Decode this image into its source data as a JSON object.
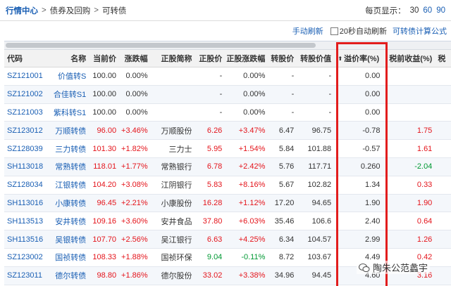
{
  "breadcrumb": {
    "home": "行情中心",
    "level2": "债券及回购",
    "level3": "可转债"
  },
  "page_size": {
    "label": "每页显示：",
    "options": [
      "30",
      "60",
      "90"
    ]
  },
  "toolbar": {
    "manual_refresh": "手动刷新",
    "auto_refresh": "20秒自动刷新",
    "formula": "可转债计算公式"
  },
  "columns": {
    "code": "代码",
    "name": "名称",
    "price": "当前价",
    "change": "涨跌幅",
    "stock_name": "正股简称",
    "stock_price": "正股价",
    "stock_change": "正股涨跌幅",
    "conv_price": "转股价",
    "conv_value": "转股价值",
    "premium": "溢价率(%)",
    "yield": "税前收益(%)",
    "tax": "税"
  },
  "sort_indicator": "⬆",
  "rows": [
    {
      "code": "SZ121001",
      "name": "价值转S",
      "price": "100.00",
      "change": "0.00%",
      "stock_name": "",
      "stock_price": "-",
      "stock_change": "0.00%",
      "conv_price": "-",
      "conv_value": "-",
      "premium": "0.00",
      "yield": "",
      "chg_dir": "flat",
      "stk_dir": "flat",
      "yld_dir": "flat"
    },
    {
      "code": "SZ121002",
      "name": "合佳转S1",
      "price": "100.00",
      "change": "0.00%",
      "stock_name": "",
      "stock_price": "-",
      "stock_change": "0.00%",
      "conv_price": "-",
      "conv_value": "-",
      "premium": "0.00",
      "yield": "",
      "chg_dir": "flat",
      "stk_dir": "flat",
      "yld_dir": "flat"
    },
    {
      "code": "SZ121003",
      "name": "紫科转S1",
      "price": "100.00",
      "change": "0.00%",
      "stock_name": "",
      "stock_price": "-",
      "stock_change": "0.00%",
      "conv_price": "-",
      "conv_value": "-",
      "premium": "0.00",
      "yield": "",
      "chg_dir": "flat",
      "stk_dir": "flat",
      "yld_dir": "flat"
    },
    {
      "code": "SZ123012",
      "name": "万顺转债",
      "price": "96.00",
      "change": "+3.46%",
      "stock_name": "万顺股份",
      "stock_price": "6.26",
      "stock_change": "+3.47%",
      "conv_price": "6.47",
      "conv_value": "96.75",
      "premium": "-0.78",
      "yield": "1.75",
      "chg_dir": "up",
      "stk_dir": "up",
      "yld_dir": "up"
    },
    {
      "code": "SZ128039",
      "name": "三力转债",
      "price": "101.30",
      "change": "+1.82%",
      "stock_name": "三力士",
      "stock_price": "5.95",
      "stock_change": "+1.54%",
      "conv_price": "5.84",
      "conv_value": "101.88",
      "premium": "-0.57",
      "yield": "1.61",
      "chg_dir": "up",
      "stk_dir": "up",
      "yld_dir": "up"
    },
    {
      "code": "SH113018",
      "name": "常熟转债",
      "price": "118.01",
      "change": "+1.77%",
      "stock_name": "常熟银行",
      "stock_price": "6.78",
      "stock_change": "+2.42%",
      "conv_price": "5.76",
      "conv_value": "117.71",
      "premium": "0.260",
      "yield": "-2.04",
      "chg_dir": "up",
      "stk_dir": "up",
      "yld_dir": "down"
    },
    {
      "code": "SZ128034",
      "name": "江银转债",
      "price": "104.20",
      "change": "+3.08%",
      "stock_name": "江阴银行",
      "stock_price": "5.83",
      "stock_change": "+8.16%",
      "conv_price": "5.67",
      "conv_value": "102.82",
      "premium": "1.34",
      "yield": "0.33",
      "chg_dir": "up",
      "stk_dir": "up",
      "yld_dir": "up"
    },
    {
      "code": "SH113016",
      "name": "小康转债",
      "price": "96.45",
      "change": "+2.21%",
      "stock_name": "小康股份",
      "stock_price": "16.28",
      "stock_change": "+1.12%",
      "conv_price": "17.20",
      "conv_value": "94.65",
      "premium": "1.90",
      "yield": "1.90",
      "chg_dir": "up",
      "stk_dir": "up",
      "yld_dir": "up"
    },
    {
      "code": "SH113513",
      "name": "安井转债",
      "price": "109.16",
      "change": "+3.60%",
      "stock_name": "安井食品",
      "stock_price": "37.80",
      "stock_change": "+6.03%",
      "conv_price": "35.46",
      "conv_value": "106.6",
      "premium": "2.40",
      "yield": "0.64",
      "chg_dir": "up",
      "stk_dir": "up",
      "yld_dir": "up"
    },
    {
      "code": "SH113516",
      "name": "吴银转债",
      "price": "107.70",
      "change": "+2.56%",
      "stock_name": "吴江银行",
      "stock_price": "6.63",
      "stock_change": "+4.25%",
      "conv_price": "6.34",
      "conv_value": "104.57",
      "premium": "2.99",
      "yield": "1.26",
      "chg_dir": "up",
      "stk_dir": "up",
      "yld_dir": "up"
    },
    {
      "code": "SZ123002",
      "name": "国祯转债",
      "price": "108.33",
      "change": "+1.88%",
      "stock_name": "国祯环保",
      "stock_price": "9.04",
      "stock_change": "-0.11%",
      "conv_price": "8.72",
      "conv_value": "103.67",
      "premium": "4.49",
      "yield": "0.42",
      "chg_dir": "up",
      "stk_dir": "down",
      "yld_dir": "up"
    },
    {
      "code": "SZ123011",
      "name": "德尔转债",
      "price": "98.80",
      "change": "+1.86%",
      "stock_name": "德尔股份",
      "stock_price": "33.02",
      "stock_change": "+3.38%",
      "conv_price": "34.96",
      "conv_value": "94.45",
      "premium": "4.60",
      "yield": "3.16",
      "chg_dir": "up",
      "stk_dir": "up",
      "yld_dir": "up"
    }
  ],
  "watermark": "陶朱公范蠡宇",
  "colors": {
    "up": "#e4141b",
    "down": "#009933",
    "link": "#1a5fb4",
    "highlight": "#e21d1d"
  }
}
